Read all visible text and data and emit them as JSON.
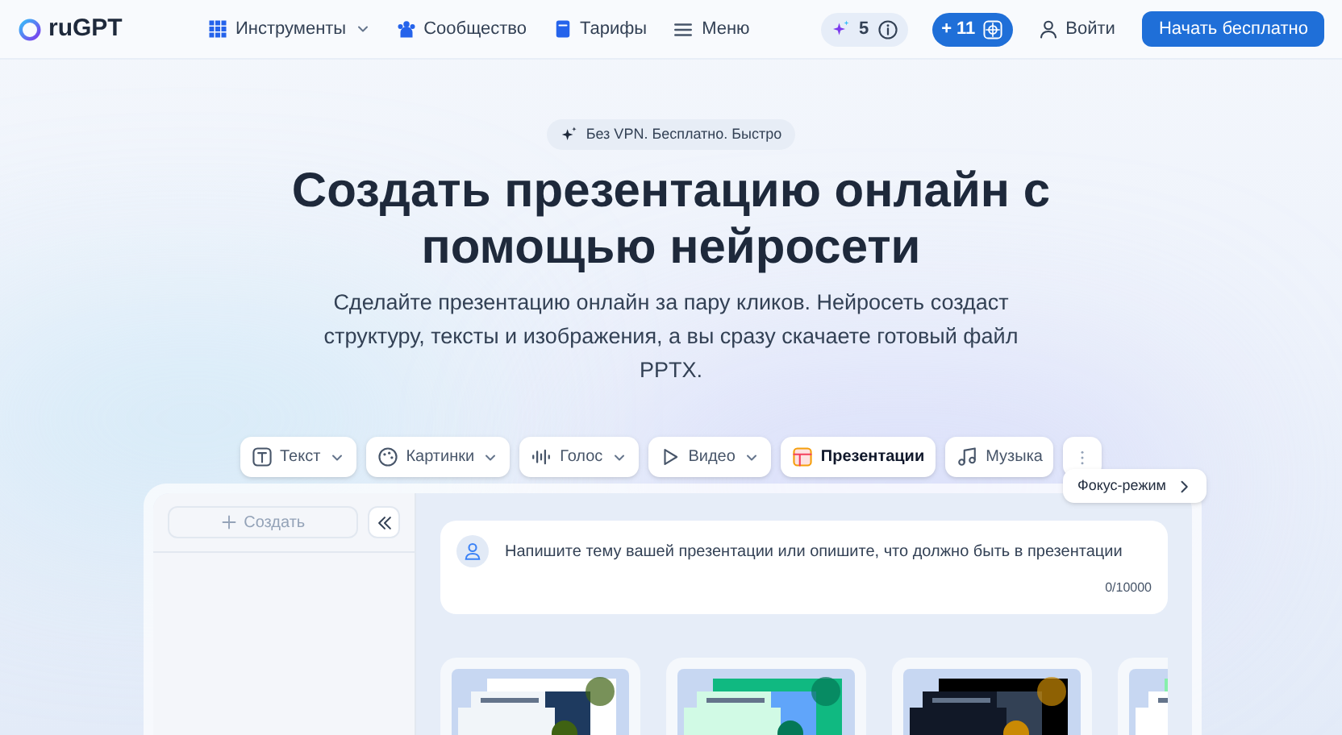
{
  "header": {
    "logo": "ruGPT",
    "nav": [
      {
        "label": "Инструменты",
        "kind": "grid",
        "dropdown": true
      },
      {
        "label": "Сообщество",
        "kind": "people",
        "dropdown": false
      },
      {
        "label": "Тарифы",
        "kind": "book",
        "dropdown": false
      },
      {
        "label": "Меню",
        "kind": "menu",
        "dropdown": false
      }
    ],
    "credits": "5",
    "bonus": "+ 11",
    "login": "Войти",
    "cta": "Начать бесплатно"
  },
  "hero": {
    "badge": "Без VPN. Бесплатно. Быстро",
    "title": "Создать презентацию онлайн с помощью нейросети",
    "subtitle": "Сделайте презентацию онлайн за пару кликов. Нейросеть создаст структуру, тексты и изображения, а вы сразу скачаете готовый файл PPTX."
  },
  "tabs": [
    {
      "label": "Текст",
      "kind": "text",
      "dropdown": true,
      "selected": false
    },
    {
      "label": "Картинки",
      "dropdown": true,
      "selected": false
    },
    {
      "label": "Голос",
      "kind": "wave",
      "dropdown": true,
      "selected": false
    },
    {
      "label": "Видео",
      "kind": "play",
      "dropdown": true,
      "selected": false
    },
    {
      "label": "Презентации",
      "kind": "slides",
      "dropdown": false,
      "selected": true
    },
    {
      "label": "Музыка",
      "kind": "music",
      "dropdown": false,
      "selected": false
    }
  ],
  "focus_mode": "Фокус-режим",
  "sidebar": {
    "create": "Создать"
  },
  "prompt": {
    "placeholder": "Напишите тему вашей презентации или опишите, что должно быть в презентации",
    "counter": "0/10000"
  }
}
